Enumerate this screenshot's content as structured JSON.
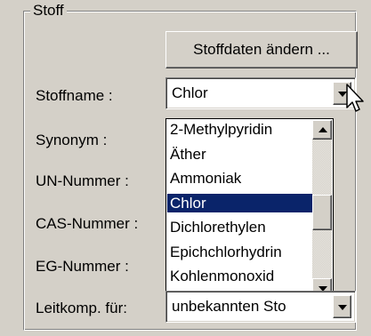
{
  "group": {
    "title": "Stoff"
  },
  "buttons": {
    "stoffdaten_label": "Stoffdaten ändern ..."
  },
  "labels": {
    "stoffname": "Stoffname :",
    "synonym": "Synonym :",
    "un_nummer": "UN-Nummer :",
    "cas_nummer": "CAS-Nummer :",
    "eg_nummer": "EG-Nummer :",
    "leitkomp": "Leitkomp. für:"
  },
  "stoffname_combo": {
    "value": "Chlor"
  },
  "leitkomp_combo": {
    "value": "unbekannten Sto"
  },
  "dropdown": {
    "items": [
      "2-Methylpyridin",
      "Äther",
      "Ammoniak",
      "Chlor",
      "Dichlorethylen",
      "Epichchlorhydrin",
      "Kohlenmonoxid"
    ],
    "selected": "Chlor"
  },
  "colors": {
    "selection": "#0a246a",
    "face": "#d4d0c8"
  },
  "icons": {
    "combo_arrow": "chevron-down-icon",
    "scroll_up": "scroll-up-icon",
    "scroll_down": "scroll-down-icon",
    "pointer": "mouse-pointer-icon"
  }
}
